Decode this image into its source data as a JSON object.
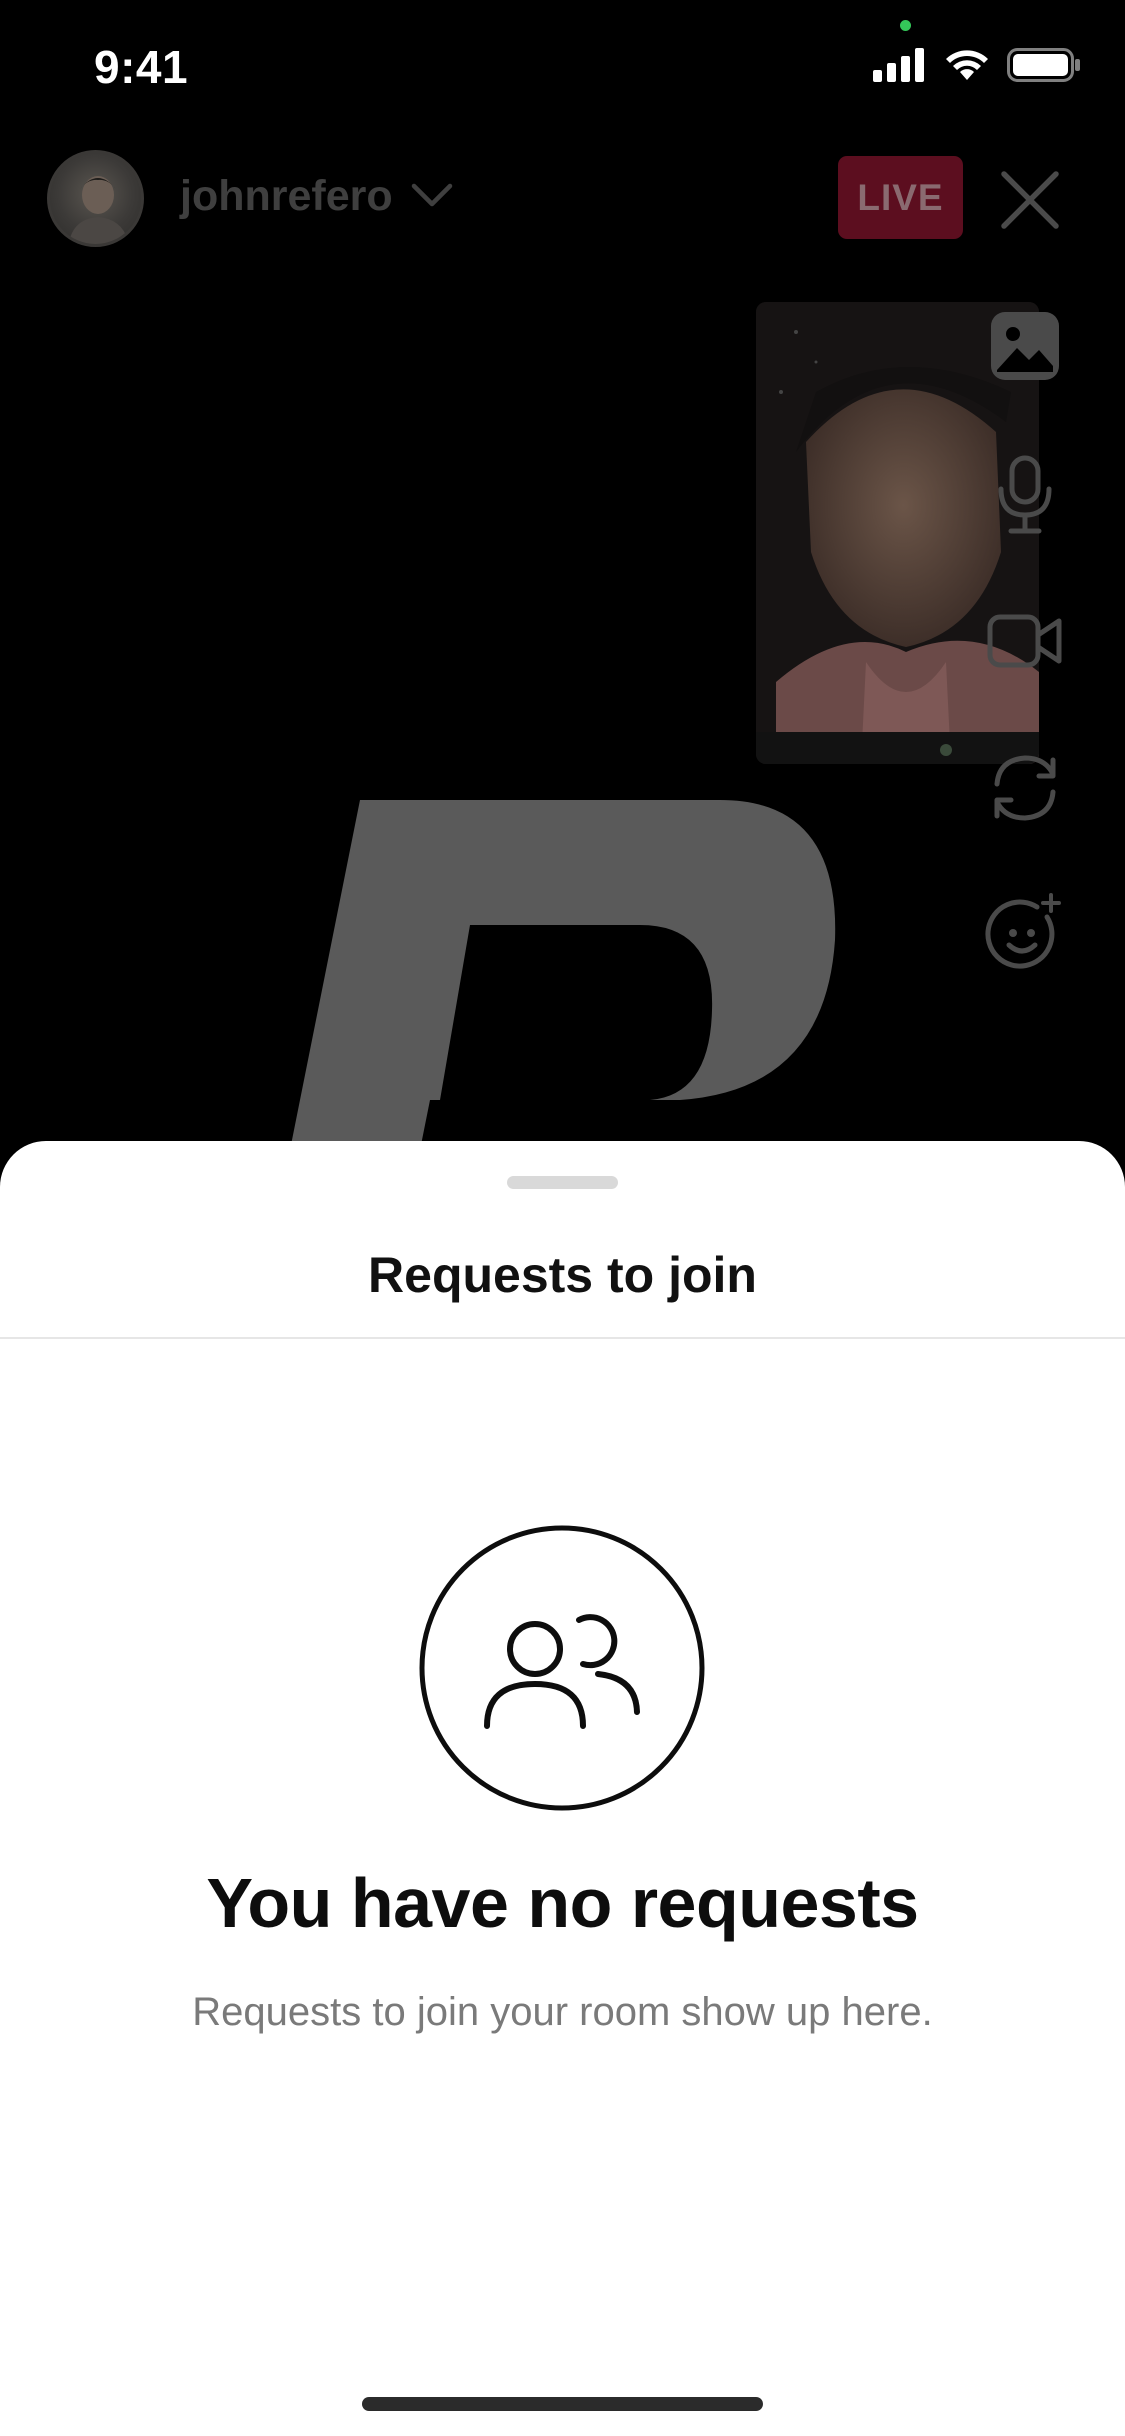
{
  "status_bar": {
    "time": "9:41"
  },
  "live_header": {
    "username": "johnrefero",
    "live_badge": "LIVE"
  },
  "side_controls": [
    "image-icon",
    "microphone-icon",
    "video-camera-icon",
    "flip-camera-icon",
    "effects-smiley-icon"
  ],
  "sheet": {
    "title": "Requests to join",
    "empty_state": {
      "icon": "people-icon",
      "title": "You have no requests",
      "subtitle": "Requests to join your room show up here."
    }
  },
  "colors": {
    "live_badge_bg": "#5c0e1f",
    "sheet_bg": "#ffffff",
    "status_dot": "#34c759"
  }
}
